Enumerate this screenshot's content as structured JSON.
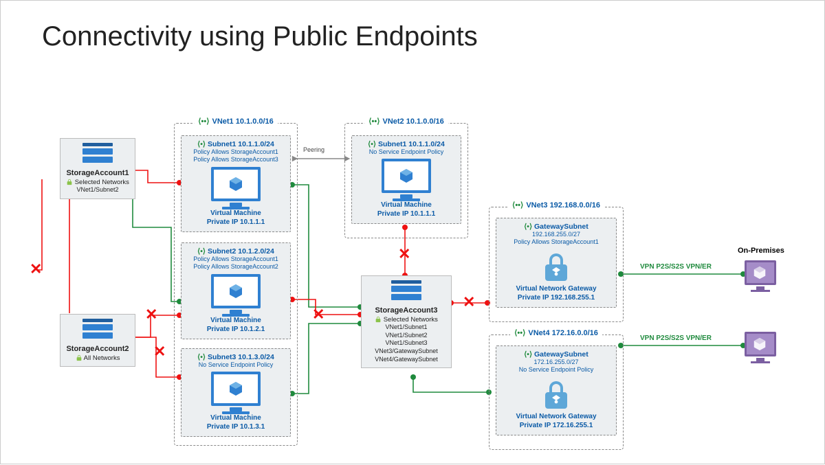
{
  "title": "Connectivity using Public Endpoints",
  "peering": "Peering",
  "vnets": {
    "v1": "VNet1 10.1.0.0/16",
    "v2": "VNet2 10.1.0.0/16",
    "v3": "VNet3 192.168.0.0/16",
    "v4": "VNet4 172.16.0.0/16"
  },
  "vnet1": {
    "s1": {
      "head": "Subnet1 10.1.1.0/24",
      "l1": "Policy Allows StorageAccount1",
      "l2": "Policy Allows StorageAccount3",
      "vm": "Virtual Machine",
      "ip": "Private IP 10.1.1.1"
    },
    "s2": {
      "head": "Subnet2 10.1.2.0/24",
      "l1": "Policy Allows StorageAccount1",
      "l2": "Policy Allows StorageAccount2",
      "vm": "Virtual Machine",
      "ip": "Private IP 10.1.2.1"
    },
    "s3": {
      "head": "Subnet3 10.1.3.0/24",
      "l1": "No Service Endpoint Policy",
      "vm": "Virtual Machine",
      "ip": "Private IP 10.1.3.1"
    }
  },
  "vnet2": {
    "s1": {
      "head": "Subnet1 10.1.1.0/24",
      "l1": "No Service Endpoint Policy",
      "vm": "Virtual Machine",
      "ip": "Private IP 10.1.1.1"
    }
  },
  "vnet3": {
    "gw": {
      "head": "GatewaySubnet",
      "sub": "192.168.255.0/27",
      "l1": "Policy Allows StorageAccount1",
      "name": "Virtual Network Gateway",
      "ip": "Private IP 192.168.255.1"
    }
  },
  "vnet4": {
    "gw": {
      "head": "GatewaySubnet",
      "sub": "172.16.255.0/27",
      "l1": "No Service Endpoint Policy",
      "name": "Virtual Network Gateway",
      "ip": "Private IP 172.16.255.1"
    }
  },
  "storage1": {
    "name": "StorageAccount1",
    "sel": "Selected Networks",
    "nets": [
      "VNet1/Subnet2"
    ]
  },
  "storage2": {
    "name": "StorageAccount2",
    "sel": "All Networks"
  },
  "storage3": {
    "name": "StorageAccount3",
    "sel": "Selected Networks",
    "nets": [
      "VNet1/Subnet1",
      "VNet1/Subnet2",
      "VNet1/Subnet3",
      "VNet3/GatewaySubnet",
      "VNet4/GatewaySubnet"
    ]
  },
  "onprem": {
    "title": "On-Premises",
    "link": "VPN P2S/S2S VPN/ER"
  }
}
